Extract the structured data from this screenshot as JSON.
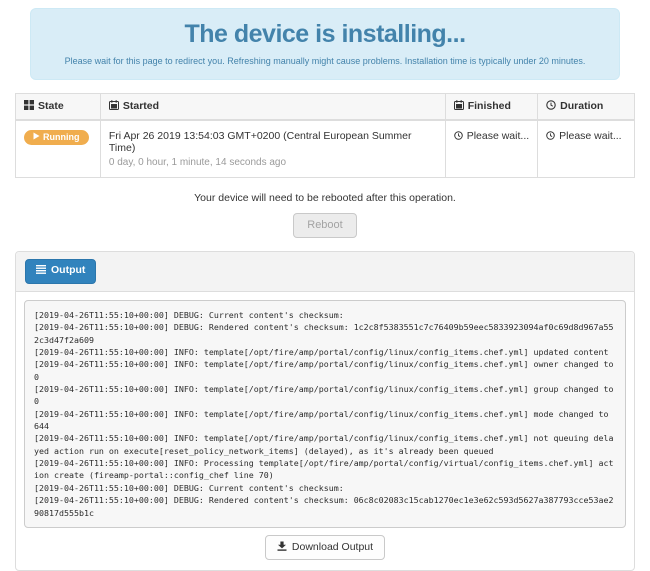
{
  "banner": {
    "title": "The device is installing...",
    "subtitle": "Please wait for this page to redirect you. Refreshing manually might cause problems. Installation time is typically under 20 minutes."
  },
  "status_table": {
    "columns": [
      {
        "label": "State",
        "icon": "th-large-icon"
      },
      {
        "label": "Started",
        "icon": "calendar-icon"
      },
      {
        "label": "Finished",
        "icon": "calendar-icon"
      },
      {
        "label": "Duration",
        "icon": "clock-icon"
      }
    ],
    "row": {
      "state_label": "Running",
      "started": "Fri Apr 26 2019 13:54:03 GMT+0200 (Central European Summer Time)",
      "started_relative": "0 day, 0 hour, 1 minute, 14 seconds ago",
      "finished": "Please wait...",
      "duration": "Please wait..."
    }
  },
  "reboot": {
    "notice": "Your device will need to be rebooted after this operation.",
    "button_label": "Reboot"
  },
  "output": {
    "toggle_label": "Output",
    "download_label": "Download Output",
    "log_lines": [
      "[2019-04-26T11:55:10+00:00] DEBUG: Current content's checksum:",
      "[2019-04-26T11:55:10+00:00] DEBUG: Rendered content's checksum: 1c2c8f5383551c7c76409b59eec5833923094af0c69d8d967a552c3d47f2a609",
      "[2019-04-26T11:55:10+00:00] INFO: template[/opt/fire/amp/portal/config/linux/config_items.chef.yml] updated content",
      "[2019-04-26T11:55:10+00:00] INFO: template[/opt/fire/amp/portal/config/linux/config_items.chef.yml] owner changed to 0",
      "[2019-04-26T11:55:10+00:00] INFO: template[/opt/fire/amp/portal/config/linux/config_items.chef.yml] group changed to 0",
      "[2019-04-26T11:55:10+00:00] INFO: template[/opt/fire/amp/portal/config/linux/config_items.chef.yml] mode changed to 644",
      "[2019-04-26T11:55:10+00:00] INFO: template[/opt/fire/amp/portal/config/linux/config_items.chef.yml] not queuing delayed action run on execute[reset_policy_network_items] (delayed), as it's already been queued",
      "[2019-04-26T11:55:10+00:00] INFO: Processing template[/opt/fire/amp/portal/config/virtual/config_items.chef.yml] action create (fireamp-portal::config_chef line 70)",
      "[2019-04-26T11:55:10+00:00] DEBUG: Current content's checksum:",
      "[2019-04-26T11:55:10+00:00] DEBUG: Rendered content's checksum: 06c8c02083c15cab1270ec1e3e62c593d5627a387793cce53ae290817d555b1c"
    ]
  },
  "colors": {
    "banner_bg": "#d9edf7",
    "banner_text": "#4383ab",
    "running_badge": "#f0ad4e",
    "output_button": "#3183bd"
  }
}
